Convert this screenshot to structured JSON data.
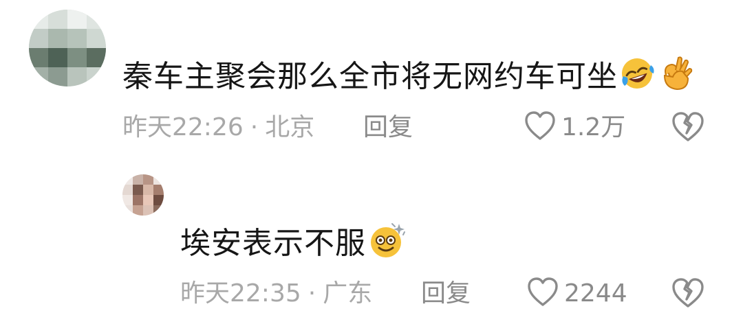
{
  "comments": [
    {
      "text": "秦车主聚会那么全市将无网约车可坐",
      "emojis": [
        "rofl-emoji",
        "ok-hand-emoji"
      ],
      "time": "昨天22:26",
      "separator": "·",
      "location": "北京",
      "reply_label": "回复",
      "likes": "1.2万"
    },
    {
      "text": "埃安表示不服",
      "emojis": [
        "dizzy-smile-emoji"
      ],
      "time": "昨天22:35",
      "separator": "·",
      "location": "广东",
      "reply_label": "回复",
      "likes": "2244"
    }
  ],
  "colors": {
    "meta_text": "#a8a8a8",
    "action_text": "#8a8a8a",
    "icon_stroke": "#8a8a8a"
  }
}
